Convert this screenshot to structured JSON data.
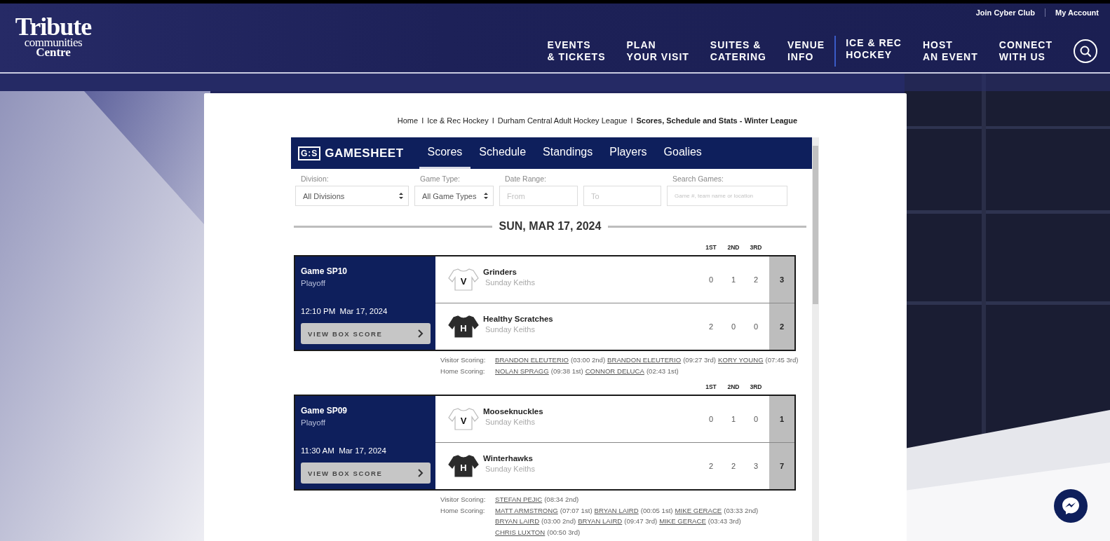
{
  "header": {
    "logo": {
      "line1": "Tribute",
      "line2": "communities",
      "line3": "Centre"
    },
    "utility_links": [
      "Join Cyber Club",
      "My Account"
    ],
    "nav": [
      {
        "line1": "EVENTS",
        "line2": "& TICKETS",
        "selected": false
      },
      {
        "line1": "PLAN",
        "line2": "YOUR VISIT",
        "selected": false
      },
      {
        "line1": "SUITES &",
        "line2": "CATERING",
        "selected": false
      },
      {
        "line1": "VENUE",
        "line2": "INFO",
        "selected": false
      },
      {
        "line1": "ICE & REC",
        "line2": "HOCKEY",
        "selected": true
      },
      {
        "line1": "HOST",
        "line2": "AN EVENT",
        "selected": false
      },
      {
        "line1": "CONNECT",
        "line2": "WITH US",
        "selected": false
      }
    ]
  },
  "breadcrumb": {
    "items": [
      {
        "label": "Home",
        "current": false
      },
      {
        "separator": "I",
        "label": "Ice & Rec Hockey",
        "current": false
      },
      {
        "separator": "I",
        "label": "Durham Central Adult Hockey League",
        "current": false
      },
      {
        "separator": "I",
        "label": "Scores, Schedule and Stats - Winter League",
        "current": true
      }
    ]
  },
  "gamesheet": {
    "logo_mark": "G:S",
    "logo": "GAMESHEET",
    "tabs": [
      {
        "label": "Scores",
        "selected": true
      },
      {
        "label": "Schedule",
        "selected": false
      },
      {
        "label": "Standings",
        "selected": false
      },
      {
        "label": "Players",
        "selected": false
      },
      {
        "label": "Goalies",
        "selected": false
      }
    ],
    "filters": [
      {
        "kind": "select",
        "label": "Division:",
        "value": "All Divisions"
      },
      {
        "kind": "select",
        "label": "Game Type:",
        "value": "All Game Types"
      },
      {
        "kind": "input",
        "label": "Date Range:",
        "placeholder": "From"
      },
      {
        "kind": "input",
        "placeholder": "To"
      },
      {
        "kind": "input",
        "label": "Search Games:",
        "placeholder": "Game #, team name or location"
      }
    ],
    "date_heading": "SUN, MAR 17, 2024",
    "games": [
      {
        "period_headers": [
          "1ST",
          "2ND",
          "3RD"
        ],
        "title": "Game SP10",
        "type": "Playoff",
        "time": "12:10 PM",
        "date": "Mar 17, 2024",
        "button": "VIEW BOX SCORE",
        "teams": [
          {
            "kind": "visitor",
            "jersey_letter": "V",
            "name": "Grinders",
            "division": "Sunday Keiths",
            "periods": [
              "0",
              "1",
              "2"
            ],
            "total": "3"
          },
          {
            "kind": "home",
            "jersey_letter": "H",
            "name": "Healthy Scratches",
            "division": "Sunday Keiths",
            "periods": [
              "2",
              "0",
              "0"
            ],
            "total": "2"
          }
        ],
        "scoring": [
          {
            "label": "Visitor Scoring:",
            "goals": [
              {
                "player": "BRANDON ELEUTERIO",
                "time": "(03:00 2nd)"
              },
              {
                "player": "BRANDON ELEUTERIO",
                "time": "(09:27 3rd)"
              },
              {
                "player": "KORY YOUNG",
                "time": "(07:45 3rd)"
              }
            ]
          },
          {
            "label": "Home Scoring:",
            "goals": [
              {
                "player": "NOLAN SPRAGG",
                "time": "(09:38 1st)"
              },
              {
                "player": "CONNOR DELUCA",
                "time": "(02:43 1st)"
              }
            ]
          }
        ]
      },
      {
        "period_headers": [
          "1ST",
          "2ND",
          "3RD"
        ],
        "title": "Game SP09",
        "type": "Playoff",
        "time": "11:30 AM",
        "date": "Mar 17, 2024",
        "button": "VIEW BOX SCORE",
        "teams": [
          {
            "kind": "visitor",
            "jersey_letter": "V",
            "name": "Mooseknuckles",
            "division": "Sunday Keiths",
            "periods": [
              "0",
              "1",
              "0"
            ],
            "total": "1"
          },
          {
            "kind": "home",
            "jersey_letter": "H",
            "name": "Winterhawks",
            "division": "Sunday Keiths",
            "periods": [
              "2",
              "2",
              "3"
            ],
            "total": "7"
          }
        ],
        "scoring": [
          {
            "label": "Visitor Scoring:",
            "goals": [
              {
                "player": "STEFAN PEJIC",
                "time": "(08:34 2nd)"
              }
            ]
          },
          {
            "label": "Home Scoring:",
            "goals": [
              {
                "player": "MATT ARMSTRONG",
                "time": "(07:07 1st)"
              },
              {
                "player": "BRYAN LAIRD",
                "time": "(00:05 1st)"
              },
              {
                "player": "MIKE GERACE",
                "time": "(03:33 2nd)"
              },
              {
                "player": "BRYAN LAIRD",
                "time": "(03:00 2nd)"
              },
              {
                "player": "BRYAN LAIRD",
                "time": "(09:47 3rd)"
              },
              {
                "player": "MIKE GERACE",
                "time": "(03:43 3rd)"
              },
              {
                "player": "CHRIS LUXTON",
                "time": "(00:50 3rd)"
              }
            ]
          }
        ]
      }
    ]
  }
}
